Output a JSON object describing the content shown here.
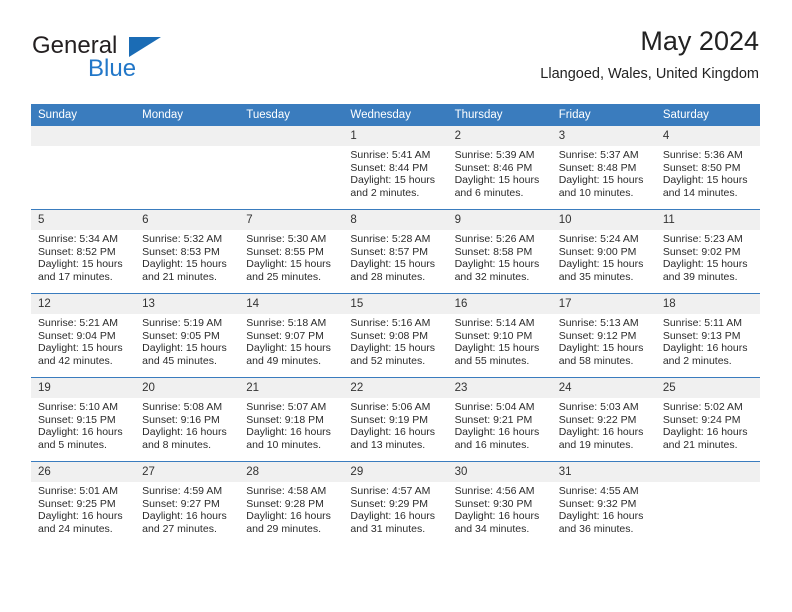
{
  "brand": {
    "name_part1": "General",
    "name_part2": "Blue",
    "accent_color": "#1b6cb5"
  },
  "header": {
    "title": "May 2024",
    "subtitle": "Llangoed, Wales, United Kingdom"
  },
  "theme": {
    "header_band": "#3a7cbe",
    "daynum_band": "#f0f0f0",
    "text": "#2b2b2b"
  },
  "weekday_headers": [
    "Sunday",
    "Monday",
    "Tuesday",
    "Wednesday",
    "Thursday",
    "Friday",
    "Saturday"
  ],
  "weeks": [
    [
      {
        "day": "",
        "lines": []
      },
      {
        "day": "",
        "lines": []
      },
      {
        "day": "",
        "lines": []
      },
      {
        "day": "1",
        "lines": [
          "Sunrise: 5:41 AM",
          "Sunset: 8:44 PM",
          "Daylight: 15 hours",
          "and 2 minutes."
        ]
      },
      {
        "day": "2",
        "lines": [
          "Sunrise: 5:39 AM",
          "Sunset: 8:46 PM",
          "Daylight: 15 hours",
          "and 6 minutes."
        ]
      },
      {
        "day": "3",
        "lines": [
          "Sunrise: 5:37 AM",
          "Sunset: 8:48 PM",
          "Daylight: 15 hours",
          "and 10 minutes."
        ]
      },
      {
        "day": "4",
        "lines": [
          "Sunrise: 5:36 AM",
          "Sunset: 8:50 PM",
          "Daylight: 15 hours",
          "and 14 minutes."
        ]
      }
    ],
    [
      {
        "day": "5",
        "lines": [
          "Sunrise: 5:34 AM",
          "Sunset: 8:52 PM",
          "Daylight: 15 hours",
          "and 17 minutes."
        ]
      },
      {
        "day": "6",
        "lines": [
          "Sunrise: 5:32 AM",
          "Sunset: 8:53 PM",
          "Daylight: 15 hours",
          "and 21 minutes."
        ]
      },
      {
        "day": "7",
        "lines": [
          "Sunrise: 5:30 AM",
          "Sunset: 8:55 PM",
          "Daylight: 15 hours",
          "and 25 minutes."
        ]
      },
      {
        "day": "8",
        "lines": [
          "Sunrise: 5:28 AM",
          "Sunset: 8:57 PM",
          "Daylight: 15 hours",
          "and 28 minutes."
        ]
      },
      {
        "day": "9",
        "lines": [
          "Sunrise: 5:26 AM",
          "Sunset: 8:58 PM",
          "Daylight: 15 hours",
          "and 32 minutes."
        ]
      },
      {
        "day": "10",
        "lines": [
          "Sunrise: 5:24 AM",
          "Sunset: 9:00 PM",
          "Daylight: 15 hours",
          "and 35 minutes."
        ]
      },
      {
        "day": "11",
        "lines": [
          "Sunrise: 5:23 AM",
          "Sunset: 9:02 PM",
          "Daylight: 15 hours",
          "and 39 minutes."
        ]
      }
    ],
    [
      {
        "day": "12",
        "lines": [
          "Sunrise: 5:21 AM",
          "Sunset: 9:04 PM",
          "Daylight: 15 hours",
          "and 42 minutes."
        ]
      },
      {
        "day": "13",
        "lines": [
          "Sunrise: 5:19 AM",
          "Sunset: 9:05 PM",
          "Daylight: 15 hours",
          "and 45 minutes."
        ]
      },
      {
        "day": "14",
        "lines": [
          "Sunrise: 5:18 AM",
          "Sunset: 9:07 PM",
          "Daylight: 15 hours",
          "and 49 minutes."
        ]
      },
      {
        "day": "15",
        "lines": [
          "Sunrise: 5:16 AM",
          "Sunset: 9:08 PM",
          "Daylight: 15 hours",
          "and 52 minutes."
        ]
      },
      {
        "day": "16",
        "lines": [
          "Sunrise: 5:14 AM",
          "Sunset: 9:10 PM",
          "Daylight: 15 hours",
          "and 55 minutes."
        ]
      },
      {
        "day": "17",
        "lines": [
          "Sunrise: 5:13 AM",
          "Sunset: 9:12 PM",
          "Daylight: 15 hours",
          "and 58 minutes."
        ]
      },
      {
        "day": "18",
        "lines": [
          "Sunrise: 5:11 AM",
          "Sunset: 9:13 PM",
          "Daylight: 16 hours",
          "and 2 minutes."
        ]
      }
    ],
    [
      {
        "day": "19",
        "lines": [
          "Sunrise: 5:10 AM",
          "Sunset: 9:15 PM",
          "Daylight: 16 hours",
          "and 5 minutes."
        ]
      },
      {
        "day": "20",
        "lines": [
          "Sunrise: 5:08 AM",
          "Sunset: 9:16 PM",
          "Daylight: 16 hours",
          "and 8 minutes."
        ]
      },
      {
        "day": "21",
        "lines": [
          "Sunrise: 5:07 AM",
          "Sunset: 9:18 PM",
          "Daylight: 16 hours",
          "and 10 minutes."
        ]
      },
      {
        "day": "22",
        "lines": [
          "Sunrise: 5:06 AM",
          "Sunset: 9:19 PM",
          "Daylight: 16 hours",
          "and 13 minutes."
        ]
      },
      {
        "day": "23",
        "lines": [
          "Sunrise: 5:04 AM",
          "Sunset: 9:21 PM",
          "Daylight: 16 hours",
          "and 16 minutes."
        ]
      },
      {
        "day": "24",
        "lines": [
          "Sunrise: 5:03 AM",
          "Sunset: 9:22 PM",
          "Daylight: 16 hours",
          "and 19 minutes."
        ]
      },
      {
        "day": "25",
        "lines": [
          "Sunrise: 5:02 AM",
          "Sunset: 9:24 PM",
          "Daylight: 16 hours",
          "and 21 minutes."
        ]
      }
    ],
    [
      {
        "day": "26",
        "lines": [
          "Sunrise: 5:01 AM",
          "Sunset: 9:25 PM",
          "Daylight: 16 hours",
          "and 24 minutes."
        ]
      },
      {
        "day": "27",
        "lines": [
          "Sunrise: 4:59 AM",
          "Sunset: 9:27 PM",
          "Daylight: 16 hours",
          "and 27 minutes."
        ]
      },
      {
        "day": "28",
        "lines": [
          "Sunrise: 4:58 AM",
          "Sunset: 9:28 PM",
          "Daylight: 16 hours",
          "and 29 minutes."
        ]
      },
      {
        "day": "29",
        "lines": [
          "Sunrise: 4:57 AM",
          "Sunset: 9:29 PM",
          "Daylight: 16 hours",
          "and 31 minutes."
        ]
      },
      {
        "day": "30",
        "lines": [
          "Sunrise: 4:56 AM",
          "Sunset: 9:30 PM",
          "Daylight: 16 hours",
          "and 34 minutes."
        ]
      },
      {
        "day": "31",
        "lines": [
          "Sunrise: 4:55 AM",
          "Sunset: 9:32 PM",
          "Daylight: 16 hours",
          "and 36 minutes."
        ]
      },
      {
        "day": "",
        "lines": []
      }
    ]
  ]
}
